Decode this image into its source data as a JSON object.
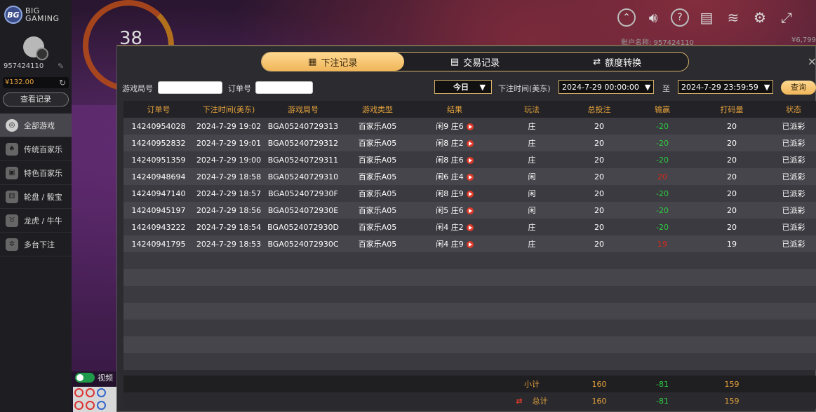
{
  "brand": {
    "logo_badge": "BG",
    "line1": "BIG",
    "line2": "GAMING"
  },
  "sidebar": {
    "account": "957424110",
    "balance": "¥132.00",
    "history_button": "查看记录",
    "items": [
      {
        "label": "全部游戏",
        "icon": "roulette-icon",
        "glyph": "◎"
      },
      {
        "label": "传统百家乐",
        "icon": "cards-icon",
        "glyph": "♠"
      },
      {
        "label": "特色百家乐",
        "icon": "card-icon",
        "glyph": "▣"
      },
      {
        "label": "轮盘 / 骰宝",
        "icon": "dice-icon",
        "glyph": "⚅"
      },
      {
        "label": "龙虎 / 牛牛",
        "icon": "bull-icon",
        "glyph": "♉"
      },
      {
        "label": "多台下注",
        "icon": "multi-table-icon",
        "glyph": "✲"
      }
    ],
    "video_toggle_label": "视频"
  },
  "background": {
    "timer": "38"
  },
  "top_icons": [
    "chevron-up-icon",
    "volume-icon",
    "help-icon",
    "document-icon",
    "wifi-icon",
    "gear-icon",
    "fullscreen-icon"
  ],
  "top_account": "账户名称: 957424110",
  "top_balance": "¥6,799",
  "tabs": [
    {
      "label": "下注记录",
      "icon": "calendar-icon",
      "glyph": "▦",
      "active": true
    },
    {
      "label": "交易记录",
      "icon": "clipboard-icon",
      "glyph": "▤",
      "active": false
    },
    {
      "label": "额度转换",
      "icon": "exchange-icon",
      "glyph": "⇄",
      "active": false
    }
  ],
  "filters": {
    "game_no_label": "游戏局号",
    "game_no_value": "",
    "order_no_label": "订单号",
    "order_no_value": "",
    "period_value": "今日",
    "time_label": "下注时间(美东)",
    "start": "2024-7-29 00:00:00",
    "to_label": "至",
    "end": "2024-7-29 23:59:59",
    "query_button": "查询"
  },
  "table": {
    "headers": [
      "订单号",
      "下注时间(美东)",
      "游戏局号",
      "游戏类型",
      "结果",
      "玩法",
      "总投注",
      "输赢",
      "打码量",
      "状态"
    ],
    "rows": [
      [
        "14240954028",
        "2024-7-29 19:02",
        "BGA05240729313",
        "百家乐A05",
        "闲9 庄6",
        "庄",
        "20",
        "-20",
        "20",
        "已派彩"
      ],
      [
        "14240952832",
        "2024-7-29 19:01",
        "BGA05240729312",
        "百家乐A05",
        "闲8 庄2",
        "庄",
        "20",
        "-20",
        "20",
        "已派彩"
      ],
      [
        "14240951359",
        "2024-7-29 19:00",
        "BGA05240729311",
        "百家乐A05",
        "闲8 庄6",
        "庄",
        "20",
        "-20",
        "20",
        "已派彩"
      ],
      [
        "14240948694",
        "2024-7-29 18:58",
        "BGA05240729310",
        "百家乐A05",
        "闲6 庄4",
        "闲",
        "20",
        "20",
        "20",
        "已派彩"
      ],
      [
        "14240947140",
        "2024-7-29 18:57",
        "BGA0524072930F",
        "百家乐A05",
        "闲8 庄9",
        "闲",
        "20",
        "-20",
        "20",
        "已派彩"
      ],
      [
        "14240945197",
        "2024-7-29 18:56",
        "BGA0524072930E",
        "百家乐A05",
        "闲5 庄6",
        "闲",
        "20",
        "-20",
        "20",
        "已派彩"
      ],
      [
        "14240943222",
        "2024-7-29 18:54",
        "BGA0524072930D",
        "百家乐A05",
        "闲4 庄2",
        "庄",
        "20",
        "-20",
        "20",
        "已派彩"
      ],
      [
        "14240941795",
        "2024-7-29 18:53",
        "BGA0524072930C",
        "百家乐A05",
        "闲4 庄9",
        "庄",
        "20",
        "19",
        "19",
        "已派彩"
      ]
    ]
  },
  "subtotal": {
    "label": "小计",
    "bet": "160",
    "winloss": "-81",
    "turnover": "159"
  },
  "total": {
    "label": "总计",
    "bet": "160",
    "winloss": "-81",
    "turnover": "159"
  }
}
